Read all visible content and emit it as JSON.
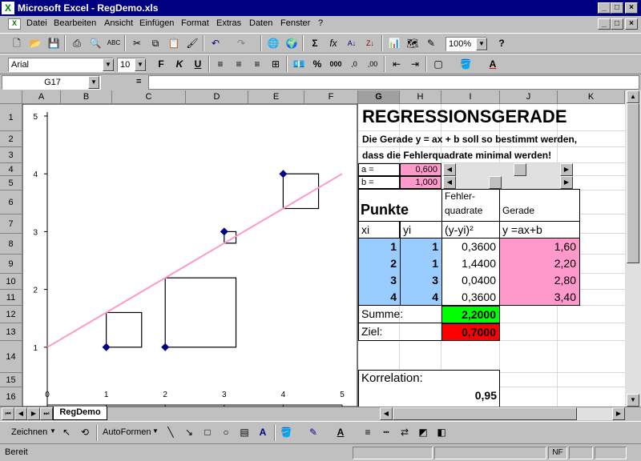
{
  "window": {
    "title": "Microsoft Excel - RegDemo.xls",
    "icon": "excel-icon"
  },
  "menu": [
    "Datei",
    "Bearbeiten",
    "Ansicht",
    "Einfügen",
    "Format",
    "Extras",
    "Daten",
    "Fenster",
    "?"
  ],
  "standard_toolbar": {
    "zoom": "100%"
  },
  "format_toolbar": {
    "font": "Arial",
    "size": "10",
    "bold": "F",
    "italic": "K",
    "underline": "U",
    "percent": "%",
    "thousands": "000",
    "dec_inc": ",0",
    "dec_dec": ",00"
  },
  "formula_bar": {
    "name_box": "G17",
    "equals": "="
  },
  "columns": [
    "A",
    "B",
    "C",
    "D",
    "E",
    "F",
    "G",
    "H",
    "I",
    "J",
    "K"
  ],
  "rows": [
    "1",
    "2",
    "3",
    "4",
    "5",
    "6",
    "7",
    "8",
    "9",
    "10",
    "11",
    "12",
    "13",
    "14",
    "15",
    "16"
  ],
  "sheet": {
    "title": "REGRESSIONSGERADE",
    "desc1": "Die Gerade y = ax + b soll so bestimmt werden,",
    "desc2": "dass die Fehlerquadrate minimal werden!",
    "a_label": "a =",
    "a_value": "0,600",
    "b_label": "b =",
    "b_value": "1,000",
    "punkte": "Punkte",
    "fehler1": "Fehler-",
    "fehler2": "quadrate",
    "gerade_hdr": "Gerade",
    "xi": "xi",
    "yi": "yi",
    "yyi": "(y-yi)²",
    "formula": "y =ax+b",
    "rows": [
      {
        "x": "1",
        "y": "1",
        "err": "0,3600",
        "line": "1,60"
      },
      {
        "x": "2",
        "y": "1",
        "err": "1,4400",
        "line": "2,20"
      },
      {
        "x": "3",
        "y": "3",
        "err": "0,0400",
        "line": "2,80"
      },
      {
        "x": "4",
        "y": "4",
        "err": "0,3600",
        "line": "3,40"
      }
    ],
    "summe_label": "Summe:",
    "summe_value": "2,2000",
    "ziel_label": "Ziel:",
    "ziel_value": "0,7000",
    "korrelation_label": "Korrelation:",
    "korrelation_value": "0,95"
  },
  "chart_data": {
    "type": "scatter",
    "x": [
      1,
      2,
      3,
      4
    ],
    "y": [
      1,
      1,
      3,
      4
    ],
    "line": {
      "a": 0.6,
      "b": 1.0
    },
    "xlim": [
      0,
      5
    ],
    "ylim": [
      0,
      5
    ],
    "xticks": [
      "0",
      "1",
      "2",
      "3",
      "4",
      "5"
    ],
    "yticks": [
      "1",
      "2",
      "3",
      "4",
      "5"
    ],
    "colors": {
      "points": "#000080",
      "line": "#ff99cc",
      "squares": "#000000"
    }
  },
  "colors": {
    "blue_cells": "#99ccff",
    "pink_cells": "#ff99cc",
    "green_cell": "#00ff00",
    "red_cell": "#ff0000",
    "title_bar": "#000080"
  },
  "tabs": {
    "active": "RegDemo"
  },
  "drawing_toolbar": {
    "zeichnen": "Zeichnen",
    "autoformen": "AutoFormen"
  },
  "status": {
    "text": "Bereit",
    "nf": "NF"
  }
}
